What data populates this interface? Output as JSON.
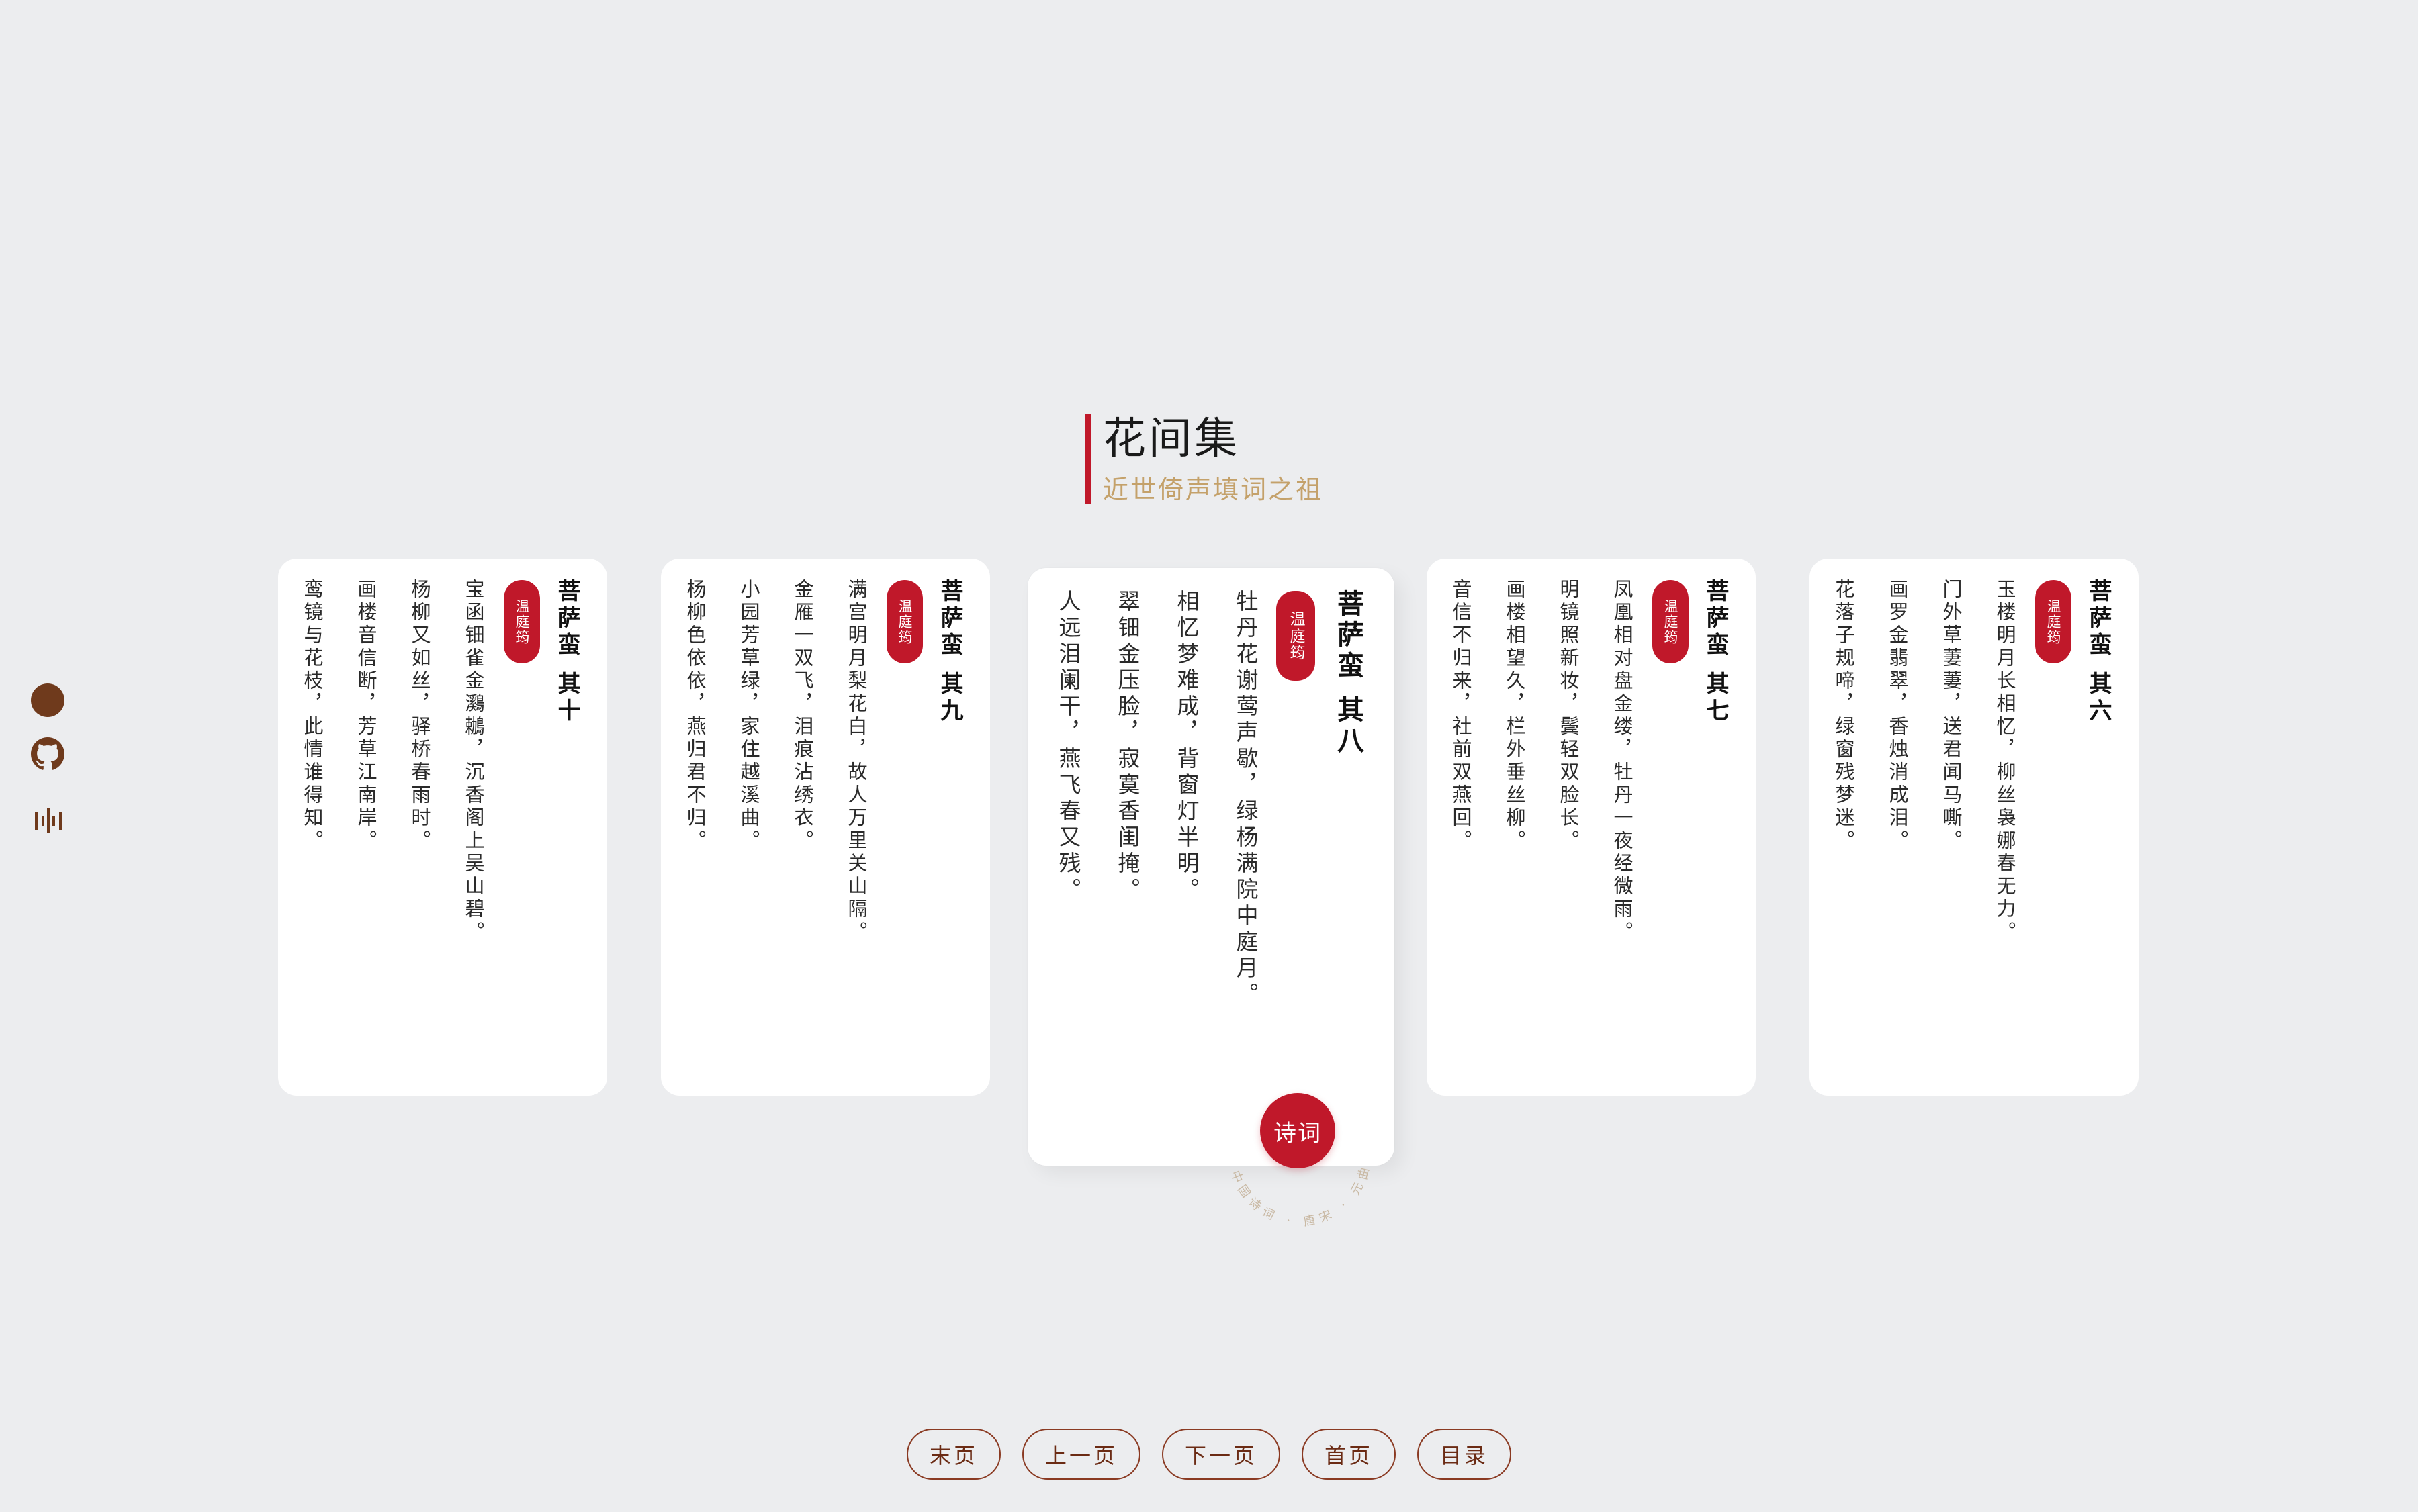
{
  "header": {
    "title": "花间集",
    "subtitle": "近世倚声填词之祖"
  },
  "side_nav": {
    "items": [
      "dot-icon",
      "github-icon",
      "audio-wave-icon"
    ]
  },
  "cards": [
    {
      "title": "菩萨蛮 其十",
      "author": "温庭筠",
      "lines": [
        "宝函钿雀金鸂鶒，沉香阁上吴山碧。",
        "杨柳又如丝，驿桥春雨时。",
        "画楼音信断，芳草江南岸。",
        "鸾镜与花枝，此情谁得知。"
      ]
    },
    {
      "title": "菩萨蛮 其九",
      "author": "温庭筠",
      "lines": [
        "满宫明月梨花白，故人万里关山隔。",
        "金雁一双飞，泪痕沾绣衣。",
        "小园芳草绿，家住越溪曲。",
        "杨柳色依依，燕归君不归。"
      ]
    },
    {
      "title": "菩萨蛮 其八",
      "author": "温庭筠",
      "lines": [
        "牡丹花谢莺声歇，绿杨满院中庭月。",
        "相忆梦难成，背窗灯半明。",
        "翠钿金压脸，寂寞香闺掩。",
        "人远泪阑干，燕飞春又残。"
      ]
    },
    {
      "title": "菩萨蛮 其七",
      "author": "温庭筠",
      "lines": [
        "凤凰相对盘金缕，牡丹一夜经微雨。",
        "明镜照新妆，鬓轻双脸长。",
        "画楼相望久，栏外垂丝柳。",
        "音信不归来，社前双燕回。"
      ]
    },
    {
      "title": "菩萨蛮 其六",
      "author": "温庭筠",
      "lines": [
        "玉楼明月长相忆，柳丝袅娜春无力。",
        "门外草萋萋，送君闻马嘶。",
        "画罗金翡翠，香烛消成泪。",
        "花落子规啼，绿窗残梦迷。"
      ]
    }
  ],
  "stamp": {
    "label": "诗词",
    "ring_text": "中国诗词 · 唐宋 · 元曲"
  },
  "pager": {
    "last": "末页",
    "prev": "上一页",
    "next": "下一页",
    "first": "首页",
    "toc": "目录"
  },
  "colors": {
    "background": "#ecedef",
    "accent_red": "#c0182a",
    "subtitle_gold": "#c4a16a",
    "brown": "#6f3a1c"
  }
}
